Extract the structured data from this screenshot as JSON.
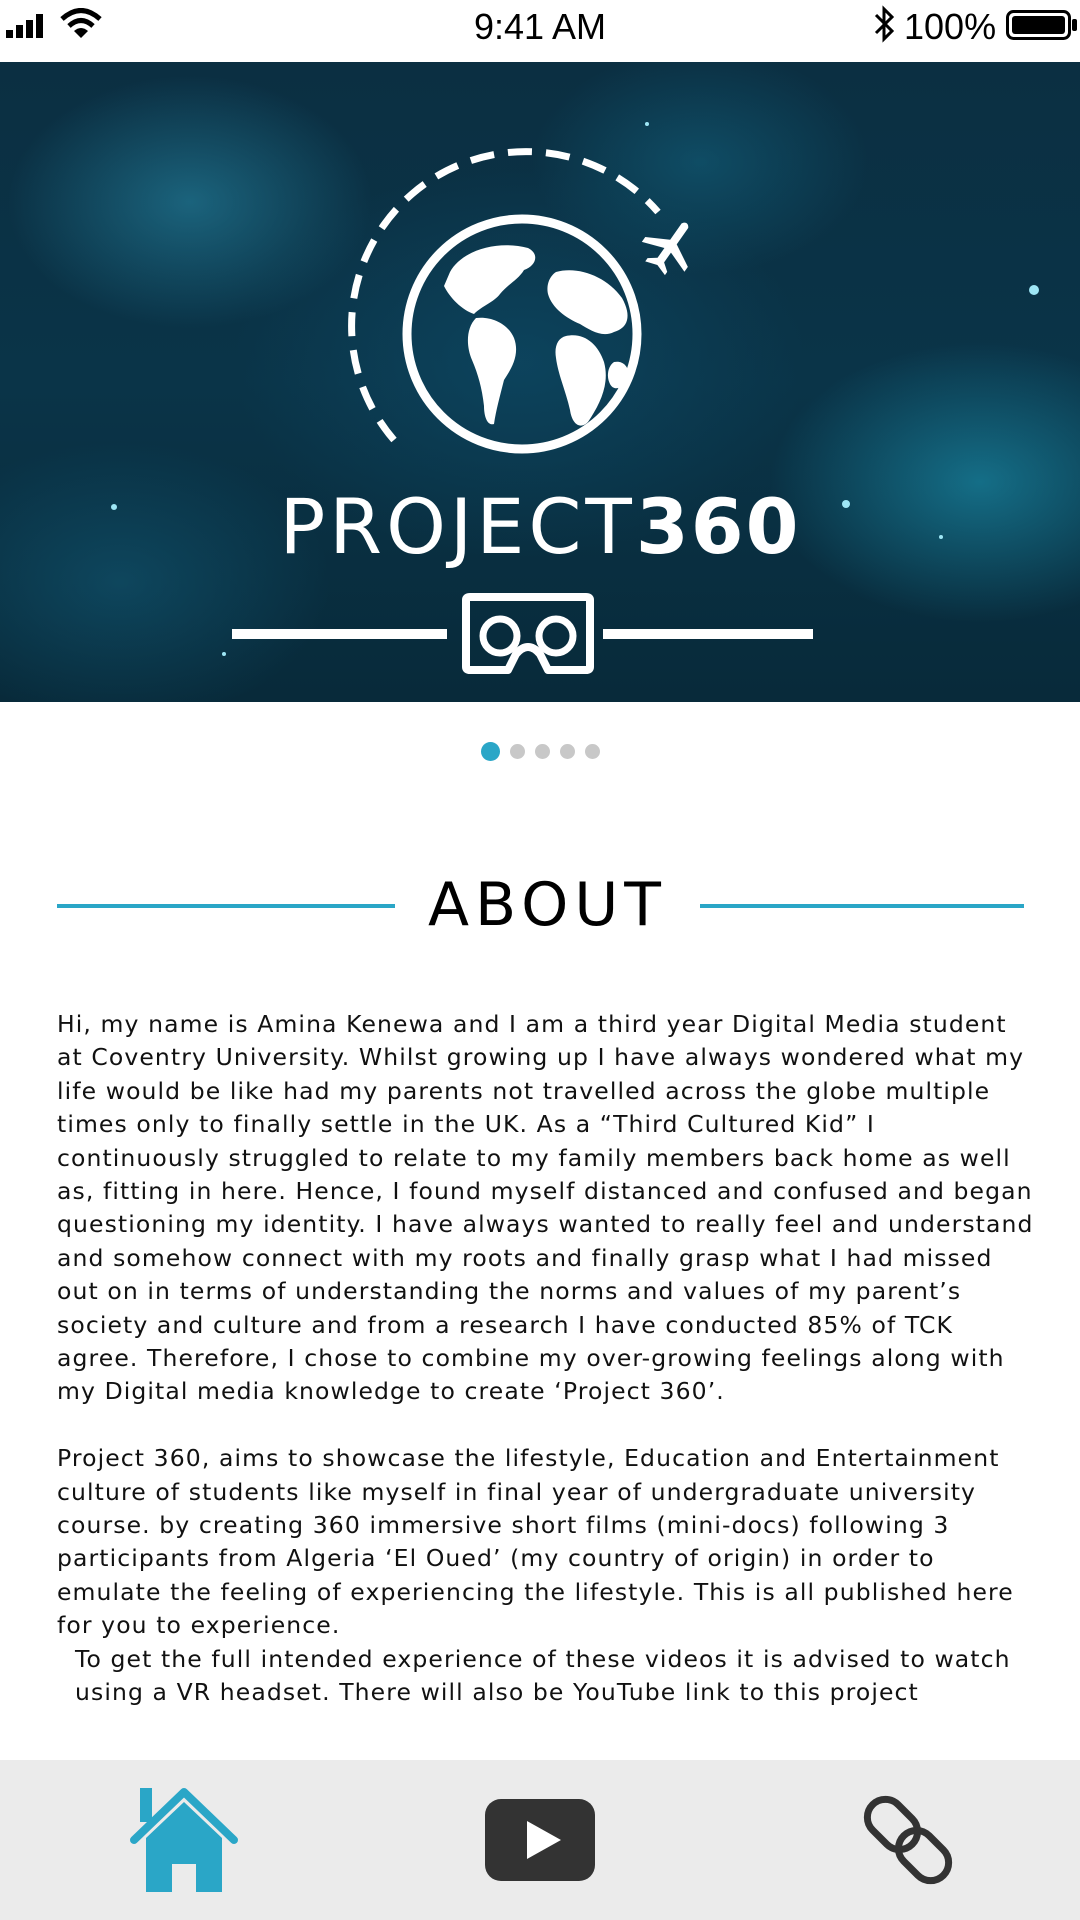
{
  "status_bar": {
    "time": "9:41 AM",
    "battery": "100%",
    "icons": [
      "signal-icon",
      "wifi-icon",
      "bluetooth-icon",
      "battery-icon"
    ]
  },
  "hero": {
    "brand_light": "PROJECT",
    "brand_bold": "360",
    "icons": [
      "globe-icon",
      "airplane-icon",
      "vr-headset-icon"
    ]
  },
  "carousel": {
    "total_slides": 5,
    "active_slide": 1
  },
  "about": {
    "title": "ABOUT",
    "paragraph1": "Hi, my name is Amina Kenewa and I am a third year Digital Media student at Coventry University. Whilst growing up I have always wondered what my life would be like had my parents not travelled across the globe multiple times only to finally settle in the UK. As a “Third Cultured Kid” I continuously struggled to relate to my family members back home as well as, fitting in here. Hence, I found myself distanced and confused and began questioning my identity. I have always wanted to really feel and understand and somehow connect with my roots and finally grasp what I had missed out on in terms of understanding the norms and values of my parent’s society and culture and from a research I have conducted 85% of TCK agree. Therefore, I chose to combine my over-growing feelings along with my Digital media knowledge to create ‘Project 360’.",
    "paragraph2": "Project 360, aims to showcase the lifestyle, Education and Entertainment culture of students like myself in final year of undergraduate university course. by creating 360 immersive short films (mini-docs) following 3 participants from Algeria ‘El Oued’ (my country of origin) in order to emulate the feeling of experiencing the lifestyle. This is all published here for you to experience.",
    "paragraph3": "To get the full intended experience of these videos it is advised to watch using a VR headset. There will also be YouTube link to this project"
  },
  "bottom_nav": {
    "items": [
      {
        "icon": "home-icon",
        "active": true
      },
      {
        "icon": "youtube-icon",
        "active": false
      },
      {
        "icon": "link-icon",
        "active": false
      }
    ],
    "accent_color": "#2aa6c7"
  },
  "colors": {
    "accent": "#2aa6c7",
    "hero_background": "#0a3448",
    "nav_background": "#ebebeb"
  }
}
